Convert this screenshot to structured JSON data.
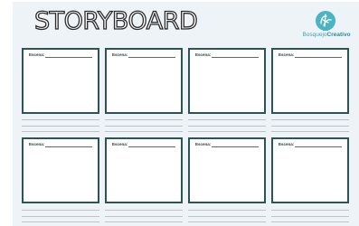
{
  "title": "STORYBOARD",
  "brand": {
    "part1": "Bosquejo",
    "part2": "Creativo",
    "accent": "#2a8fa0"
  },
  "frames": [
    {
      "label": "Escena:"
    },
    {
      "label": "Escena:"
    },
    {
      "label": "Escena:"
    },
    {
      "label": "Escena:"
    },
    {
      "label": "Escena:"
    },
    {
      "label": "Escena:"
    },
    {
      "label": "Escena:"
    },
    {
      "label": "Escena:"
    }
  ],
  "colors": {
    "frame_border": "#2c5452",
    "background": "#eef3f7"
  }
}
